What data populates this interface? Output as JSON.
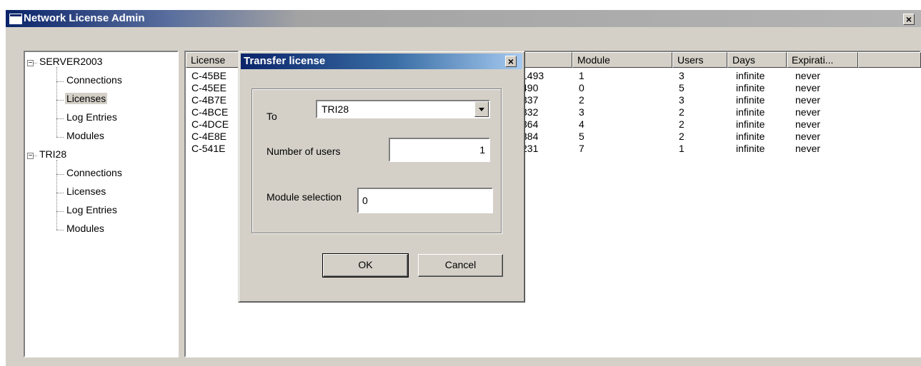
{
  "window": {
    "title": "Network License Admin",
    "close_glyph": "×"
  },
  "tree": [
    {
      "label": "SERVER2003",
      "expander": "−",
      "children": [
        "Connections",
        "Licenses",
        "Log Entries",
        "Modules"
      ]
    },
    {
      "label": "TRI28",
      "expander": "−",
      "children": [
        "Connections",
        "Licenses",
        "Log Entries",
        "Modules"
      ]
    }
  ],
  "list": {
    "columns": [
      "License",
      "",
      "Module",
      "Users",
      "Days",
      "Expirati..."
    ],
    "rows": [
      {
        "license": "C-45BE",
        "id": "1493",
        "module": "1",
        "users": "3",
        "days": "infinite",
        "expiration": "never"
      },
      {
        "license": "C-45EE",
        "id": "490",
        "module": "0",
        "users": "5",
        "days": "infinite",
        "expiration": "never"
      },
      {
        "license": "C-4B7E",
        "id": "337",
        "module": "2",
        "users": "3",
        "days": "infinite",
        "expiration": "never"
      },
      {
        "license": "C-4BCE",
        "id": "332",
        "module": "3",
        "users": "2",
        "days": "infinite",
        "expiration": "never"
      },
      {
        "license": "C-4DCE",
        "id": "364",
        "module": "4",
        "users": "2",
        "days": "infinite",
        "expiration": "never"
      },
      {
        "license": "C-4E8E",
        "id": "384",
        "module": "5",
        "users": "2",
        "days": "infinite",
        "expiration": "never"
      },
      {
        "license": "C-541E",
        "id": "231",
        "module": "7",
        "users": "1",
        "days": "infinite",
        "expiration": "never"
      }
    ]
  },
  "dialog": {
    "title": "Transfer license",
    "close_glyph": "×",
    "to_label": "To",
    "to_value": "TRI28",
    "users_label": "Number of users",
    "users_value": "1",
    "module_label": "Module selection",
    "module_value": "0",
    "ok_label": "OK",
    "cancel_label": "Cancel"
  },
  "colors": {
    "titlebar_active": "#0a246a",
    "face": "#d4d0c8"
  }
}
